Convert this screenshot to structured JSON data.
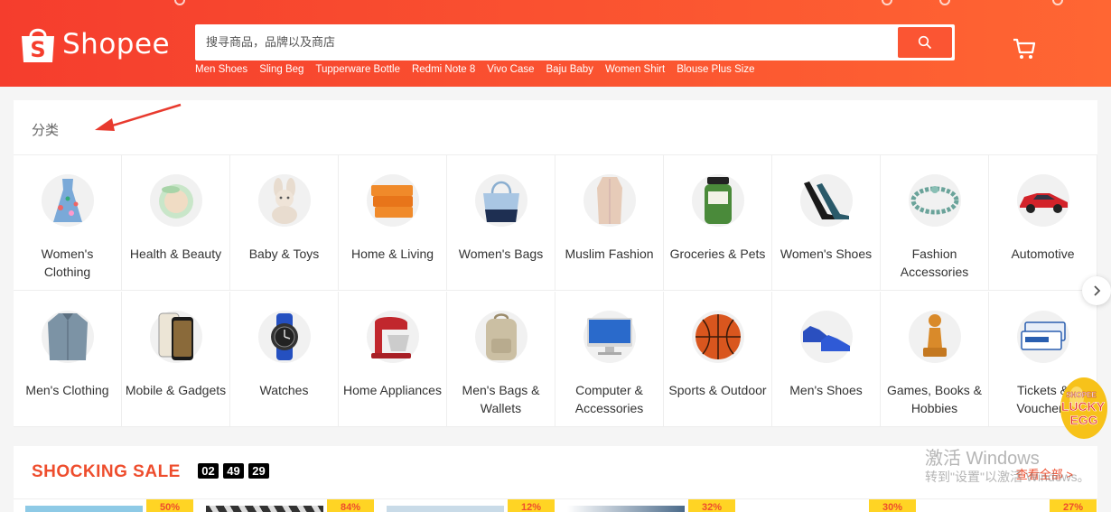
{
  "header": {
    "brand": "Shopee",
    "search_placeholder": "搜寻商品，品牌以及商店",
    "hot_keywords": [
      "Men Shoes",
      "Sling Beg",
      "Tupperware Bottle",
      "Redmi Note 8",
      "Vivo Case",
      "Baju Baby",
      "Women Shirt",
      "Blouse Plus Size"
    ]
  },
  "categories": {
    "title": "分类",
    "items": [
      {
        "label": "Women's Clothing",
        "icon": "dress-icon"
      },
      {
        "label": "Health & Beauty",
        "icon": "compact-powder-icon"
      },
      {
        "label": "Baby & Toys",
        "icon": "plush-bunny-icon"
      },
      {
        "label": "Home & Living",
        "icon": "storage-box-icon"
      },
      {
        "label": "Women's Bags",
        "icon": "tote-bag-icon"
      },
      {
        "label": "Muslim Fashion",
        "icon": "robe-icon"
      },
      {
        "label": "Groceries & Pets",
        "icon": "jar-icon"
      },
      {
        "label": "Women's Shoes",
        "icon": "high-heels-icon"
      },
      {
        "label": "Fashion Accessories",
        "icon": "bracelet-icon"
      },
      {
        "label": "Automotive",
        "icon": "sports-car-icon"
      },
      {
        "label": "Men's Clothing",
        "icon": "shirt-icon"
      },
      {
        "label": "Mobile & Gadgets",
        "icon": "smartphone-icon"
      },
      {
        "label": "Watches",
        "icon": "watch-icon"
      },
      {
        "label": "Home Appliances",
        "icon": "stand-mixer-icon"
      },
      {
        "label": "Men's Bags & Wallets",
        "icon": "backpack-icon"
      },
      {
        "label": "Computer & Accessories",
        "icon": "monitor-icon"
      },
      {
        "label": "Sports & Outdoor",
        "icon": "basketball-icon"
      },
      {
        "label": "Men's Shoes",
        "icon": "sneakers-icon"
      },
      {
        "label": "Games, Books & Hobbies",
        "icon": "chess-pawn-icon"
      },
      {
        "label": "Tickets & Vouchers",
        "icon": "ticket-icon"
      }
    ]
  },
  "shocking_sale": {
    "title": "SHOCKING SALE",
    "timer": [
      "02",
      "49",
      "29"
    ],
    "see_all": "查看全部 >",
    "badges": [
      "50%",
      "84%",
      "12%",
      "32%",
      "30%",
      "27%"
    ]
  },
  "watermark": {
    "line1": "激活 Windows",
    "line2": "转到\"设置\"以激活 Windows。"
  },
  "lucky_egg": {
    "line1": "SHOPEE",
    "line2": "LUCKY",
    "line3": "EGG"
  },
  "colors": {
    "brand": "#ee4d2d",
    "header_start": "#f53d2d",
    "header_end": "#ff6633",
    "badge": "#ffd424"
  }
}
